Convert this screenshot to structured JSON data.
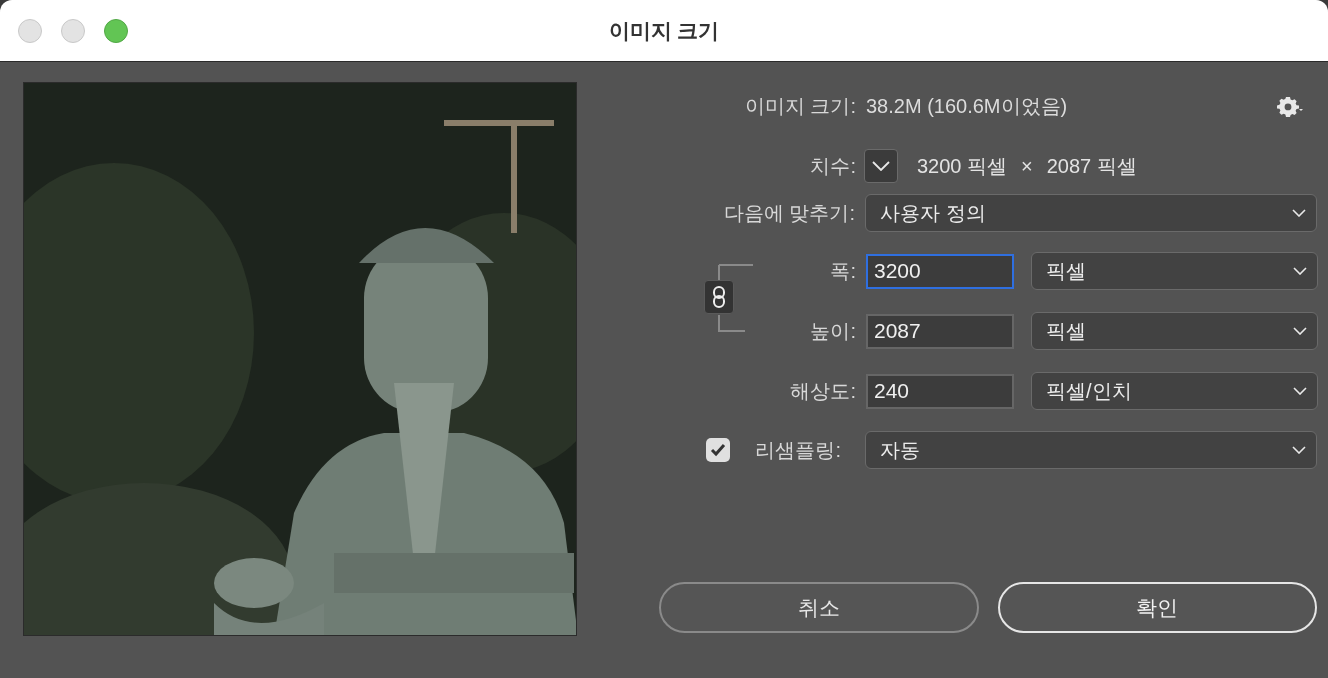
{
  "window": {
    "title": "이미지 크기"
  },
  "image_size": {
    "label": "이미지 크기:",
    "value": "38.2M (160.6M이었음)"
  },
  "dimensions": {
    "label": "치수:",
    "width": "3200 픽셀",
    "separator": "×",
    "height": "2087 픽셀"
  },
  "fit_to": {
    "label": "다음에 맞추기:",
    "value": "사용자 정의"
  },
  "linked": true,
  "fields": [
    {
      "label": "폭:",
      "value": "3200",
      "unit": "픽셀",
      "focused": true
    },
    {
      "label": "높이:",
      "value": "2087",
      "unit": "픽셀",
      "focused": false
    },
    {
      "label": "해상도:",
      "value": "240",
      "unit": "픽셀/인치",
      "focused": false
    }
  ],
  "resample": {
    "label": "리샘플링:",
    "checked": true,
    "value": "자동"
  },
  "buttons": [
    {
      "label": "취소",
      "default": false
    },
    {
      "label": "확인",
      "default": true
    }
  ]
}
